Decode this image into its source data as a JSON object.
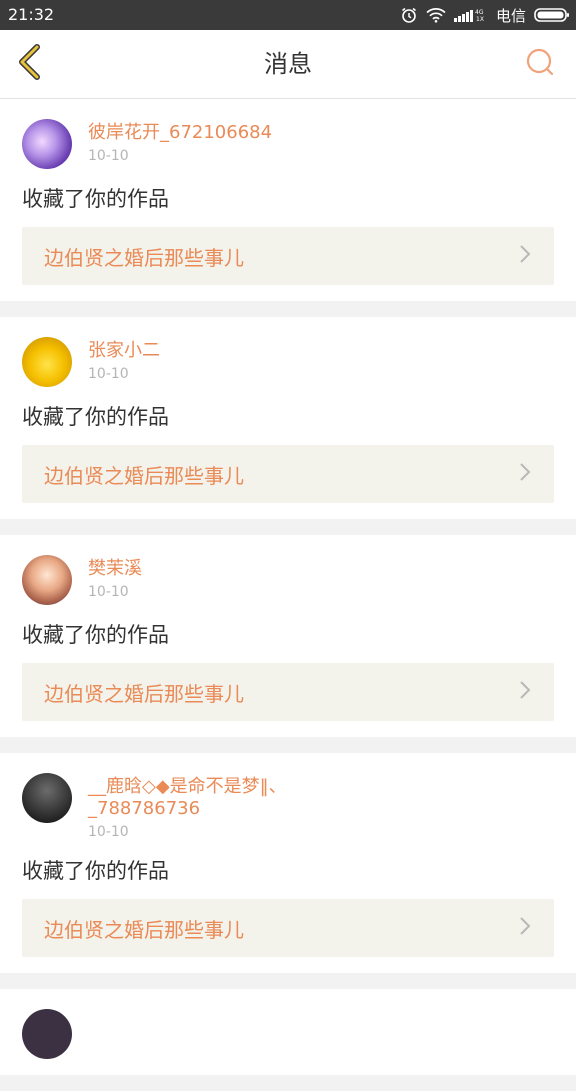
{
  "status_bar": {
    "time": "21:32",
    "carrier": "电信",
    "icons": [
      "alarm-icon",
      "wifi-icon",
      "signal-icon",
      "battery-icon"
    ]
  },
  "header": {
    "title": "消息",
    "back_icon": "chevron-left-icon",
    "search_icon": "search-icon",
    "accent_color": "#e6a23c"
  },
  "messages": [
    {
      "username": "彼岸花开_672106684",
      "date": "10-10",
      "action": "收藏了你的作品",
      "work_title": "边伯贤之婚后那些事儿"
    },
    {
      "username": "张家小二",
      "date": "10-10",
      "action": "收藏了你的作品",
      "work_title": "边伯贤之婚后那些事儿"
    },
    {
      "username": "樊茉溪",
      "date": "10-10",
      "action": "收藏了你的作品",
      "work_title": "边伯贤之婚后那些事儿"
    },
    {
      "username": "__鹿晗◇◆是命不是梦‖、_788786736",
      "date": "10-10",
      "action": "收藏了你的作品",
      "work_title": "边伯贤之婚后那些事儿"
    }
  ],
  "colors": {
    "username": "#ea8a56",
    "date": "#b5b5b5",
    "card_link_bg": "#f3f3ec",
    "page_bg": "#f2f2f2"
  }
}
